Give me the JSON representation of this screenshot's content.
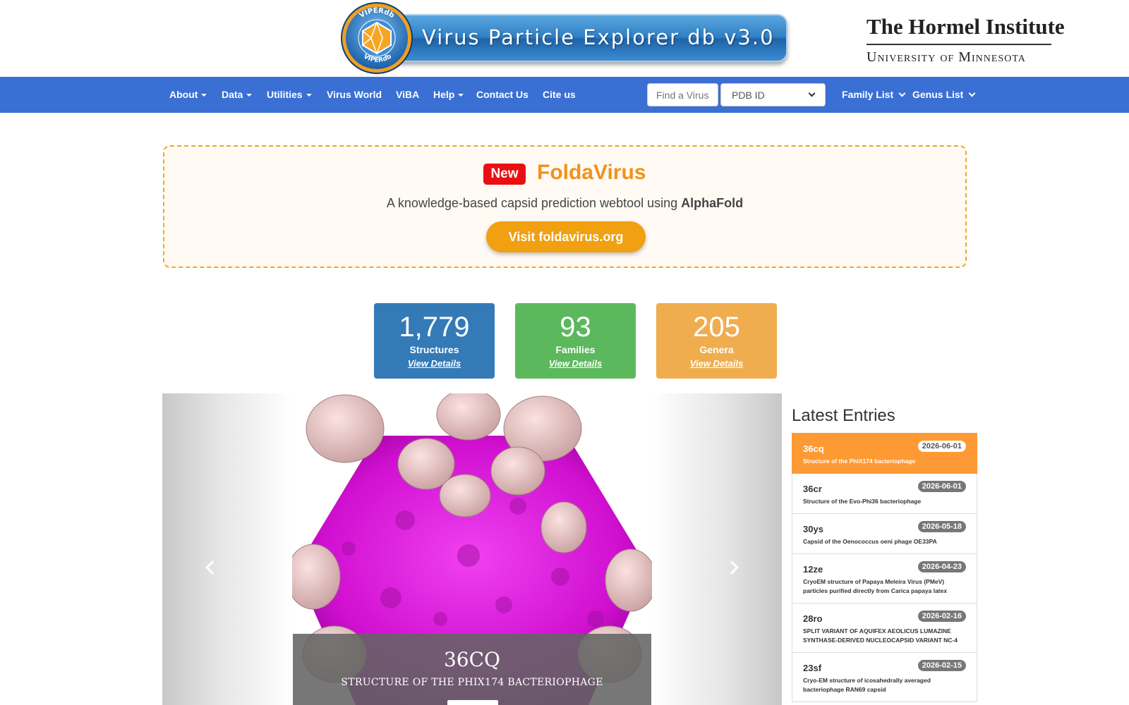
{
  "header": {
    "banner_logo_text": "VIPERdb",
    "banner_title": "Virus Particle Explorer db v3.0",
    "institute_name": "The Hormel Institute",
    "institute_university": "University of Minnesota"
  },
  "nav": {
    "items": [
      "About",
      "Data",
      "Utilities",
      "Virus World",
      "ViBA",
      "Help",
      "Contact Us",
      "Cite us"
    ],
    "search_placeholder": "Find a Virus",
    "search_type": "PDB ID",
    "family_list": "Family List",
    "genus_list": "Genus List"
  },
  "announcement": {
    "badge": "New",
    "title": "FoldaVirus",
    "desc_prefix": "A knowledge-based capsid prediction webtool using ",
    "desc_bold": "AlphaFold",
    "button": "Visit foldavirus.org",
    "colors": {
      "border": "#f5a623",
      "badge": "#ea0f12",
      "title": "#f0921c",
      "button": "#f0a010"
    }
  },
  "stats": [
    {
      "value": "1,779",
      "label": "Structures",
      "link": "View Details",
      "color": "#337ab7"
    },
    {
      "value": "93",
      "label": "Families",
      "link": "View Details",
      "color": "#5cb85c"
    },
    {
      "value": "205",
      "label": "Genera",
      "link": "View Details",
      "color": "#f0ad4e"
    }
  ],
  "carousel": {
    "title": "36CQ",
    "subtitle": "Structure of the PhiX174 bacteriophage",
    "colors": {
      "capsid": "#e020e0",
      "spikes": "#f0c8c8"
    }
  },
  "latest": {
    "title": "Latest Entries",
    "entries": [
      {
        "id": "36cq",
        "date": "2026-06-01",
        "desc": "Structure of the PhiX174 bacteriophage"
      },
      {
        "id": "36cr",
        "date": "2026-06-01",
        "desc": "Structure of the Evo-Phi36 bacteriophage"
      },
      {
        "id": "30ys",
        "date": "2026-05-18",
        "desc": "Capsid of the Oenococcus oeni phage OE33PA"
      },
      {
        "id": "12ze",
        "date": "2026-04-23",
        "desc": "CryoEM structure of Papaya Meleira Virus (PMeV) particles purified directly from Carica papaya latex"
      },
      {
        "id": "28ro",
        "date": "2026-02-16",
        "desc": "SPLIT VARIANT OF AQUIFEX AEOLICUS LUMAZINE SYNTHASE-DERIVED NUCLEOCAPSID VARIANT NC-4"
      },
      {
        "id": "23sf",
        "date": "2026-02-15",
        "desc": "Cryo-EM structure of icosahedrally averaged bacteriophage RAN69 capsid"
      }
    ]
  }
}
